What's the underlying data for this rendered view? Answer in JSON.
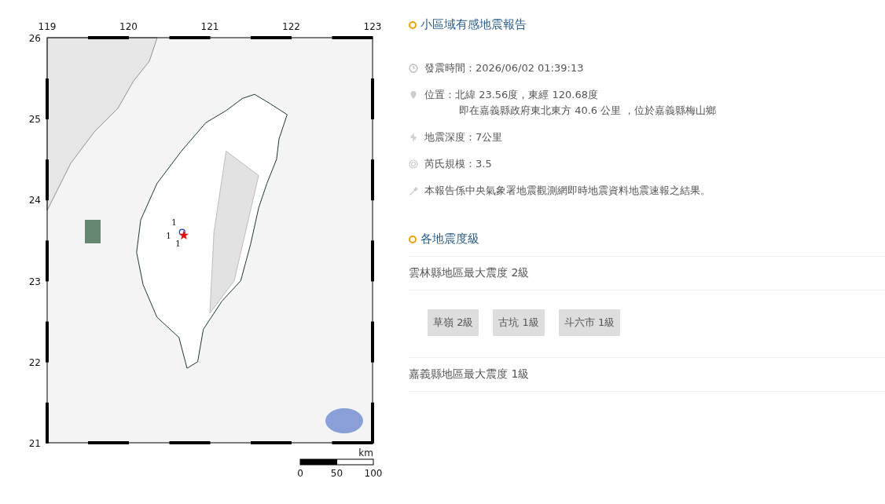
{
  "map": {
    "lon_ticks": [
      "119",
      "120",
      "121",
      "122",
      "123"
    ],
    "lat_ticks": [
      "26",
      "25",
      "24",
      "23",
      "22",
      "21"
    ],
    "intensity_labels": [
      "1",
      "1",
      "1"
    ],
    "scale": {
      "unit": "km",
      "labels": [
        "0",
        "50",
        "100"
      ]
    }
  },
  "report": {
    "title": "小區域有感地震報告",
    "items": [
      {
        "kind": "time",
        "lines": [
          "發震時間：2026/06/02 01:39:13"
        ]
      },
      {
        "kind": "location",
        "lines": [
          "位置：北緯 23.56度，東經 120.68度",
          "即在嘉義縣政府東北東方 40.6 公里 ，位於嘉義縣梅山鄉"
        ]
      },
      {
        "kind": "depth",
        "lines": [
          "地震深度：7公里"
        ]
      },
      {
        "kind": "magnitude",
        "lines": [
          "芮氏規模：3.5"
        ]
      },
      {
        "kind": "note",
        "lines": [
          "本報告係中央氣象署地震觀測網即時地震資料地震速報之結果。"
        ]
      }
    ]
  },
  "intensity": {
    "title": "各地震度級",
    "regions": [
      {
        "heading": "雲林縣地區最大震度 2級",
        "stations": [
          "草嶺 2級",
          "古坑 1級",
          "斗六市 1級"
        ]
      },
      {
        "heading": "嘉義縣地區最大震度 1級"
      }
    ]
  }
}
